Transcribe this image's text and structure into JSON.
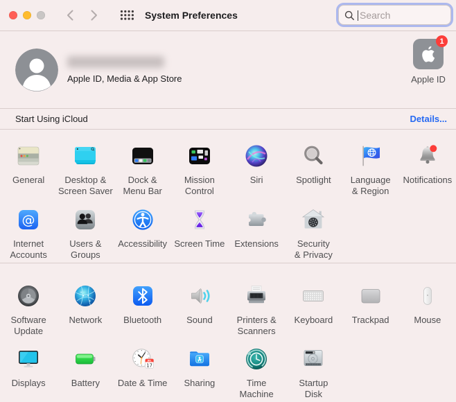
{
  "toolbar": {
    "title": "System Preferences",
    "search_placeholder": "Search"
  },
  "account": {
    "subtitle": "Apple ID, Media & App Store",
    "apple_id_label": "Apple ID",
    "badge_count": "1"
  },
  "icloud": {
    "label": "Start Using iCloud",
    "details_label": "Details..."
  },
  "grid": {
    "rows": [
      [
        {
          "label": "General"
        },
        {
          "label": "Desktop &\nScreen Saver"
        },
        {
          "label": "Dock &\nMenu Bar"
        },
        {
          "label": "Mission\nControl"
        },
        {
          "label": "Siri"
        },
        {
          "label": "Spotlight"
        },
        {
          "label": "Language\n& Region"
        },
        {
          "label": "Notifications"
        }
      ],
      [
        {
          "label": "Internet\nAccounts"
        },
        {
          "label": "Users &\nGroups"
        },
        {
          "label": "Accessibility"
        },
        {
          "label": "Screen Time"
        },
        {
          "label": "Extensions"
        },
        {
          "label": "Security\n& Privacy"
        }
      ],
      [
        {
          "label": "Software\nUpdate"
        },
        {
          "label": "Network"
        },
        {
          "label": "Bluetooth"
        },
        {
          "label": "Sound"
        },
        {
          "label": "Printers &\nScanners"
        },
        {
          "label": "Keyboard"
        },
        {
          "label": "Trackpad"
        },
        {
          "label": "Mouse"
        }
      ],
      [
        {
          "label": "Displays"
        },
        {
          "label": "Battery"
        },
        {
          "label": "Date & Time"
        },
        {
          "label": "Sharing"
        },
        {
          "label": "Time\nMachine"
        },
        {
          "label": "Startup\nDisk"
        }
      ]
    ]
  },
  "colors": {
    "window_bg": "#f6eded",
    "accent_blue": "#2468f2",
    "badge_red": "#fc3d39"
  }
}
